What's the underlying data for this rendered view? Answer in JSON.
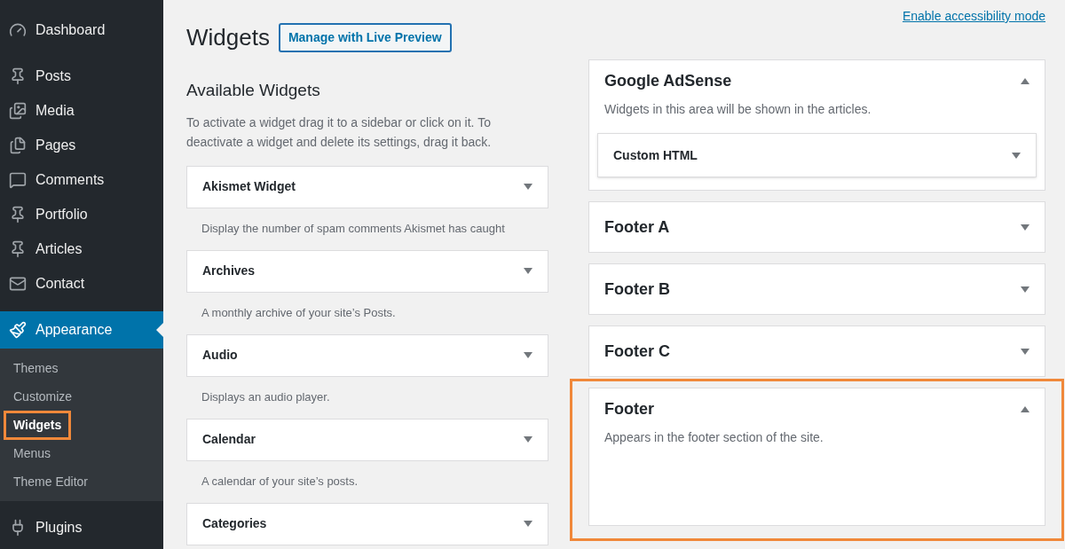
{
  "sidebar": {
    "items": [
      {
        "label": "Dashboard",
        "selected": false
      },
      {
        "label": "Posts",
        "selected": false
      },
      {
        "label": "Media",
        "selected": false
      },
      {
        "label": "Pages",
        "selected": false
      },
      {
        "label": "Comments",
        "selected": false
      },
      {
        "label": "Portfolio",
        "selected": false
      },
      {
        "label": "Articles",
        "selected": false
      },
      {
        "label": "Contact",
        "selected": false
      },
      {
        "label": "Appearance",
        "selected": true,
        "children": [
          {
            "label": "Themes",
            "selected": false,
            "highlighted": false
          },
          {
            "label": "Customize",
            "selected": false,
            "highlighted": false
          },
          {
            "label": "Widgets",
            "selected": true,
            "highlighted": true
          },
          {
            "label": "Menus",
            "selected": false,
            "highlighted": false
          },
          {
            "label": "Theme Editor",
            "selected": false,
            "highlighted": false
          }
        ]
      },
      {
        "label": "Plugins",
        "selected": false
      }
    ]
  },
  "accessibility_link": "Enable accessibility mode",
  "page_title": "Widgets",
  "live_preview_button": "Manage with Live Preview",
  "available": {
    "title": "Available Widgets",
    "description": "To activate a widget drag it to a sidebar or click on it. To deactivate a widget and delete its settings, drag it back.",
    "widgets": [
      {
        "name": "Akismet Widget",
        "description": "Display the number of spam comments Akismet has caught"
      },
      {
        "name": "Archives",
        "description": "A monthly archive of your site’s Posts."
      },
      {
        "name": "Audio",
        "description": "Displays an audio player."
      },
      {
        "name": "Calendar",
        "description": "A calendar of your site’s posts."
      },
      {
        "name": "Categories"
      }
    ]
  },
  "areas": [
    {
      "title": "Google AdSense",
      "expanded": true,
      "highlighted": false,
      "description": "Widgets in this area will be shown in the articles.",
      "widgets": [
        "Custom HTML"
      ]
    },
    {
      "title": "Footer A",
      "expanded": false,
      "highlighted": false
    },
    {
      "title": "Footer B",
      "expanded": false,
      "highlighted": false
    },
    {
      "title": "Footer C",
      "expanded": false,
      "highlighted": false
    },
    {
      "title": "Footer",
      "expanded": true,
      "highlighted": true,
      "description": "Appears in the footer section of the site."
    }
  ]
}
